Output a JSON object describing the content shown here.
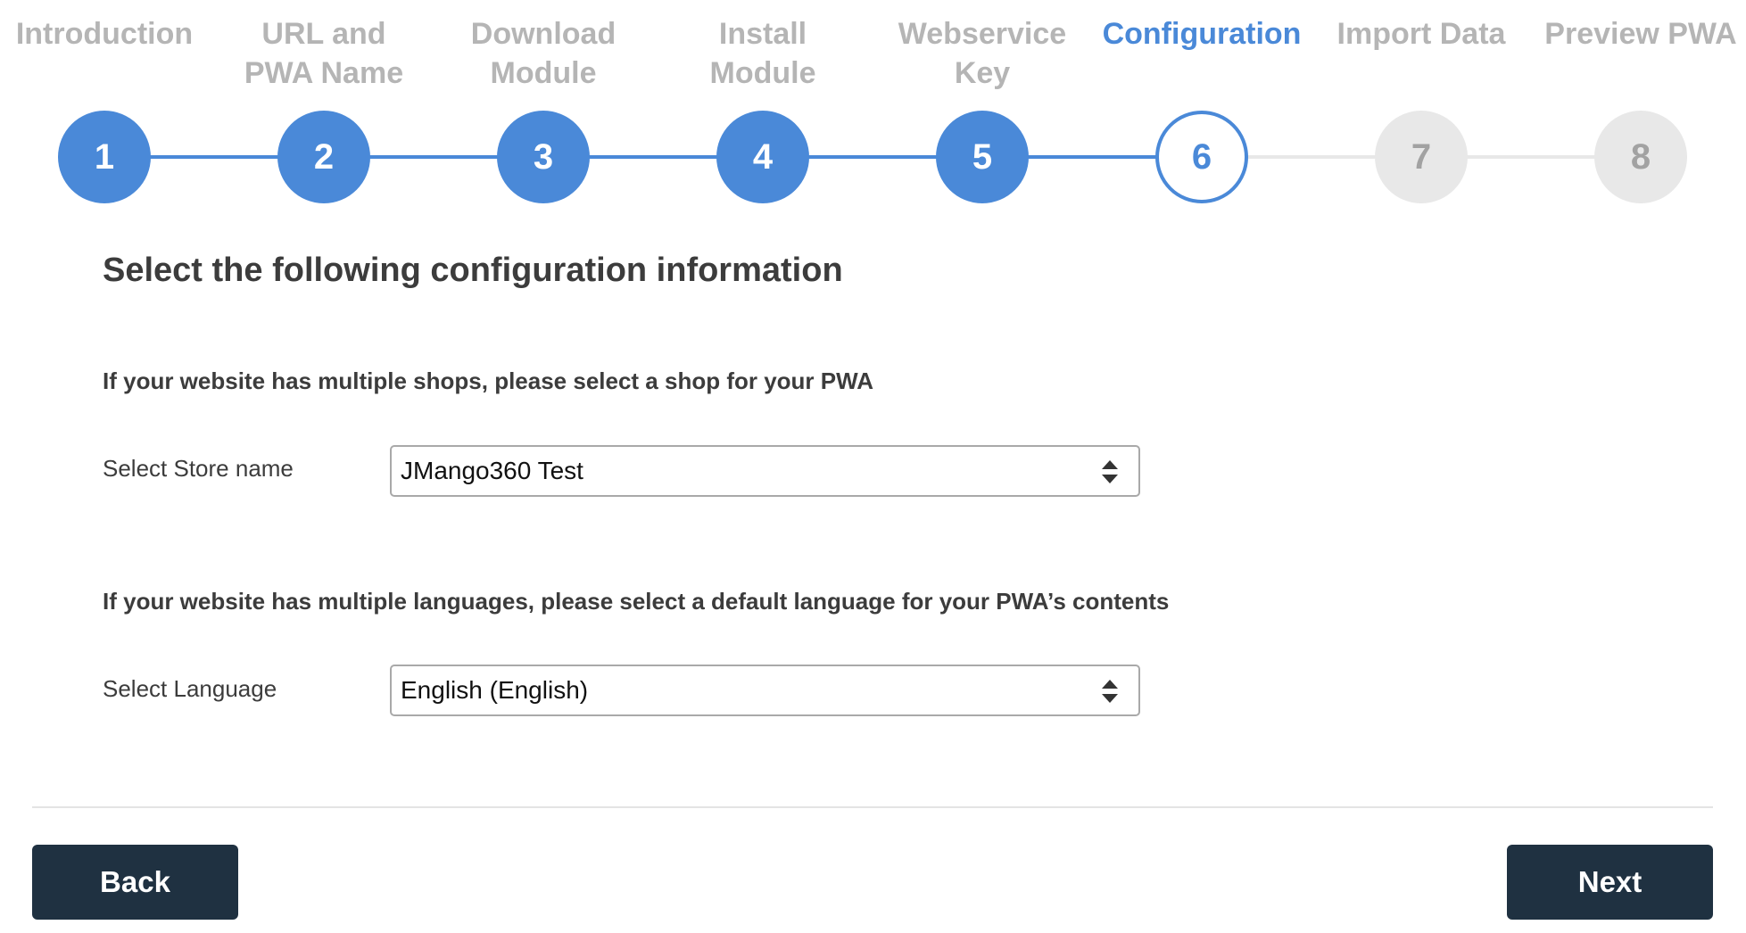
{
  "wizard": {
    "steps": [
      {
        "number": "1",
        "label_line1": "Introduction",
        "label_line2": "",
        "state": "done"
      },
      {
        "number": "2",
        "label_line1": "URL and",
        "label_line2": "PWA Name",
        "state": "done"
      },
      {
        "number": "3",
        "label_line1": "Download",
        "label_line2": "Module",
        "state": "done"
      },
      {
        "number": "4",
        "label_line1": "Install",
        "label_line2": "Module",
        "state": "done"
      },
      {
        "number": "5",
        "label_line1": "Webservice",
        "label_line2": "Key",
        "state": "done"
      },
      {
        "number": "6",
        "label_line1": "Configuration",
        "label_line2": "",
        "state": "current"
      },
      {
        "number": "7",
        "label_line1": "Import Data",
        "label_line2": "",
        "state": "todo"
      },
      {
        "number": "8",
        "label_line1": "Preview PWA",
        "label_line2": "",
        "state": "todo"
      }
    ]
  },
  "content": {
    "title": "Select the following configuration information",
    "shop_section": {
      "heading": "If your website has multiple shops, please select a shop for your PWA",
      "field_label": "Select Store name",
      "selected_value": "JMango360 Test",
      "arrow_icon": "select-updown-arrows-icon"
    },
    "language_section": {
      "heading": "If your website has multiple languages, please select a default language for your PWA’s contents",
      "field_label": "Select Language",
      "selected_value": "English (English)",
      "arrow_icon": "select-updown-arrows-icon"
    }
  },
  "footer": {
    "back_label": "Back",
    "next_label": "Next"
  },
  "colors": {
    "accent": "#4a89d8",
    "inactive_step": "#e8e8e8",
    "inactive_text": "#b5b5b5",
    "button_bg": "#1f3141",
    "button_text": "#ffffff"
  }
}
